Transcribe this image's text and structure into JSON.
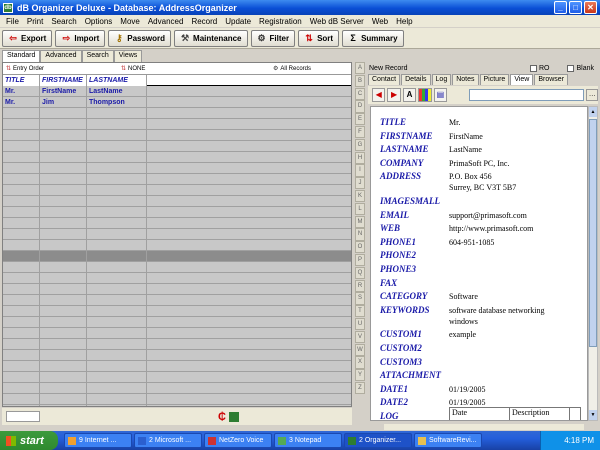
{
  "window": {
    "title": "dB Organizer Deluxe - Database: AddressOrganizer"
  },
  "menu": [
    "File",
    "Print",
    "Search",
    "Options",
    "Move",
    "Advanced",
    "Record",
    "Update",
    "Registration",
    "Web dB Server",
    "Web",
    "Help"
  ],
  "toolbar": {
    "export": "Export",
    "import": "Import",
    "password": "Password",
    "maintenance": "Maintenance",
    "filter": "Filter",
    "sort": "Sort",
    "summary": "Summary"
  },
  "left_tabs": [
    "Standard",
    "Advanced",
    "Search",
    "Views"
  ],
  "left_header": {
    "sort_order": "Entry Order",
    "filter": "NONE",
    "records": "All Records"
  },
  "grid": {
    "columns": [
      "TITLE",
      "FIRSTNAME",
      "LASTNAME"
    ],
    "rows": [
      [
        "Mr.",
        "FirstName",
        "LastName"
      ],
      [
        "Mr.",
        "Jim",
        "Thompson"
      ]
    ]
  },
  "alphabet": [
    "A",
    "B",
    "C",
    "D",
    "E",
    "F",
    "G",
    "H",
    "I",
    "J",
    "K",
    "L",
    "M",
    "N",
    "O",
    "P",
    "Q",
    "R",
    "S",
    "T",
    "U",
    "V",
    "W",
    "X",
    "Y",
    "Z"
  ],
  "right_header": {
    "record_label": "New Record",
    "ro_label": "RO",
    "blank_label": "Blank"
  },
  "right_tabs": [
    "Contact",
    "Details",
    "Log",
    "Notes",
    "Picture",
    "View",
    "Browser"
  ],
  "record": [
    {
      "label": "TITLE",
      "value": "Mr."
    },
    {
      "label": "FIRSTNAME",
      "value": "FirstName"
    },
    {
      "label": "LASTNAME",
      "value": "LastName"
    },
    {
      "label": "COMPANY",
      "value": "PrimaSoft PC, Inc."
    },
    {
      "label": "ADDRESS",
      "value": "P.O. Box 456",
      "value2": "Surrey, BC V3T 5B7"
    },
    {
      "label": "IMAGESMALL",
      "value": ""
    },
    {
      "label": "EMAIL",
      "value": "support@primasoft.com"
    },
    {
      "label": "WEB",
      "value": "http://www.primasoft.com"
    },
    {
      "label": "PHONE1",
      "value": "604-951-1085"
    },
    {
      "label": "PHONE2",
      "value": ""
    },
    {
      "label": "PHONE3",
      "value": ""
    },
    {
      "label": "FAX",
      "value": ""
    },
    {
      "label": "CATEGORY",
      "value": "Software"
    },
    {
      "label": "KEYWORDS",
      "value": "software database networking",
      "value2": "windows"
    },
    {
      "label": "CUSTOM1",
      "value": "example"
    },
    {
      "label": "CUSTOM2",
      "value": ""
    },
    {
      "label": "CUSTOM3",
      "value": ""
    },
    {
      "label": "ATTACHMENT",
      "value": ""
    },
    {
      "label": "DATE1",
      "value": "01/19/2005"
    },
    {
      "label": "DATE2",
      "value": "01/19/2005"
    },
    {
      "label": "LOG",
      "value": ""
    }
  ],
  "log_table": {
    "col1": "Date",
    "col2": "Description"
  },
  "taskbar": {
    "start": "start",
    "tasks": [
      "9 Internet ...",
      "2 Microsoft ...",
      "NetZero Voice",
      "3 Notepad",
      "2 Organizer...",
      "SoftwareRevi..."
    ],
    "clock": "4:18 PM"
  }
}
